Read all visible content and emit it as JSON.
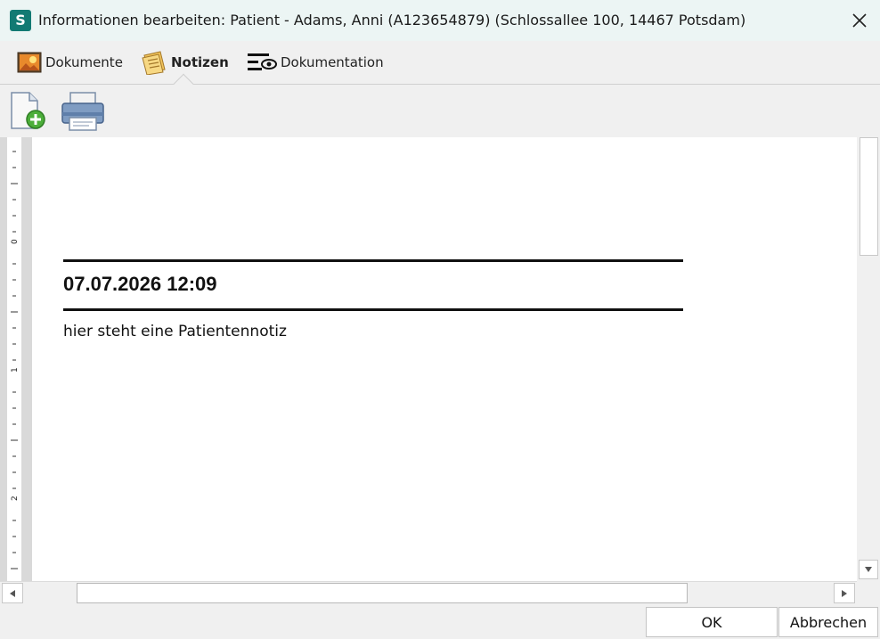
{
  "window": {
    "app_icon_letter": "S",
    "title": "Informationen bearbeiten: Patient - Adams, Anni (A123654879) (Schlossallee 100,  14467 Potsdam)",
    "close_icon": "close-icon"
  },
  "tabs": [
    {
      "label": "Dokumente",
      "icon": "document-image-icon",
      "active": false
    },
    {
      "label": "Notizen",
      "icon": "notes-icon",
      "active": true
    },
    {
      "label": "Dokumentation",
      "icon": "documentation-view-icon",
      "active": false
    }
  ],
  "toolbar": {
    "new_note_icon": "new-document-icon",
    "print_icon": "printer-icon"
  },
  "ruler": {
    "labels": [
      "0",
      "1",
      "2"
    ]
  },
  "note": {
    "date": "07.07.2026 12:09",
    "text": "hier steht eine Patientennotiz"
  },
  "buttons": {
    "ok": "OK",
    "cancel": "Abbrechen"
  },
  "colors": {
    "app_icon": "#127a73",
    "titlebar": "#ecf5f4",
    "background": "#f0f0f0"
  }
}
